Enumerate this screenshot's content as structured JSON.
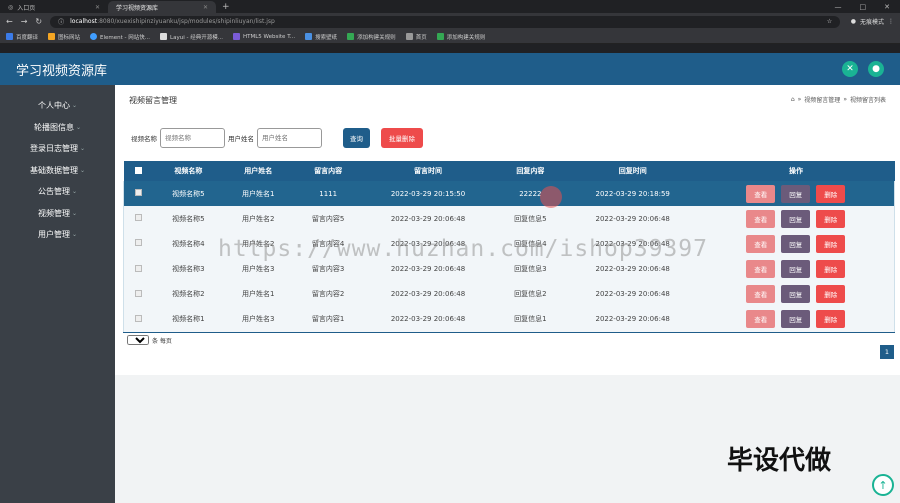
{
  "browser": {
    "tabs": [
      {
        "label": "入口页"
      },
      {
        "label": "学习视频资源库"
      }
    ],
    "url_host": "localhost",
    "url_path": ":8080/xuexishipinziyuanku/jsp/modules/shipinliuyan/list.jsp",
    "profile": "无痕模式",
    "bookmarks": [
      "百度翻译",
      "图标网站",
      "Element - 网站快...",
      "Layui - 经典开源模...",
      "HTML5 Website T...",
      "搜索壁纸",
      "添加构建关规则",
      "首页",
      "添加构建关规则"
    ]
  },
  "app": {
    "title": "学习视频资源库"
  },
  "sidebar": {
    "items": [
      {
        "label": "个人中心"
      },
      {
        "label": "轮播图信息"
      },
      {
        "label": "登录日志管理"
      },
      {
        "label": "基础数据管理"
      },
      {
        "label": "公告管理"
      },
      {
        "label": "视频管理"
      },
      {
        "label": "用户管理"
      }
    ]
  },
  "page": {
    "heading": "视频留言管理",
    "breadcrumb": [
      "视频留言管理",
      "视频留言列表"
    ]
  },
  "search": {
    "video_label": "视频名称",
    "video_placeholder": "视频名称",
    "user_label": "用户姓名",
    "user_placeholder": "用户姓名",
    "query_button": "查询",
    "batch_delete_button": "批量删除"
  },
  "table": {
    "headers": [
      "视频名称",
      "用户姓名",
      "留言内容",
      "留言时间",
      "回复内容",
      "回复时间",
      "操作"
    ],
    "rows": [
      {
        "video": "视频名称5",
        "user": "用户姓名1",
        "content": "1111",
        "time": "2022-03-29 20:15:50",
        "reply": "22222",
        "reply_time": "2022-03-29 20:18:59"
      },
      {
        "video": "视频名称5",
        "user": "用户姓名2",
        "content": "留言内容5",
        "time": "2022-03-29 20:06:48",
        "reply": "回复信息5",
        "reply_time": "2022-03-29 20:06:48"
      },
      {
        "video": "视频名称4",
        "user": "用户姓名2",
        "content": "留言内容4",
        "time": "2022-03-29 20:06:48",
        "reply": "回复信息4",
        "reply_time": "2022-03-29 20:06:48"
      },
      {
        "video": "视频名称3",
        "user": "用户姓名3",
        "content": "留言内容3",
        "time": "2022-03-29 20:06:48",
        "reply": "回复信息3",
        "reply_time": "2022-03-29 20:06:48"
      },
      {
        "video": "视频名称2",
        "user": "用户姓名1",
        "content": "留言内容2",
        "time": "2022-03-29 20:06:48",
        "reply": "回复信息2",
        "reply_time": "2022-03-29 20:06:48"
      },
      {
        "video": "视频名称1",
        "user": "用户姓名3",
        "content": "留言内容1",
        "time": "2022-03-29 20:06:48",
        "reply": "回复信息1",
        "reply_time": "2022-03-29 20:06:48"
      }
    ],
    "actions": {
      "view": "查看",
      "reply": "回复",
      "delete": "删除"
    }
  },
  "pager": {
    "page_size": "10",
    "suffix": "条 每页",
    "current_page": "1"
  },
  "overlay": {
    "watermark": "https://www.huzhan.com/ishop39397",
    "stamp": "毕设代做"
  },
  "colors": {
    "header": "#1f5d8a",
    "sidebar": "#3a4047",
    "danger": "#ee4b4b",
    "accent": "#1ab394"
  }
}
